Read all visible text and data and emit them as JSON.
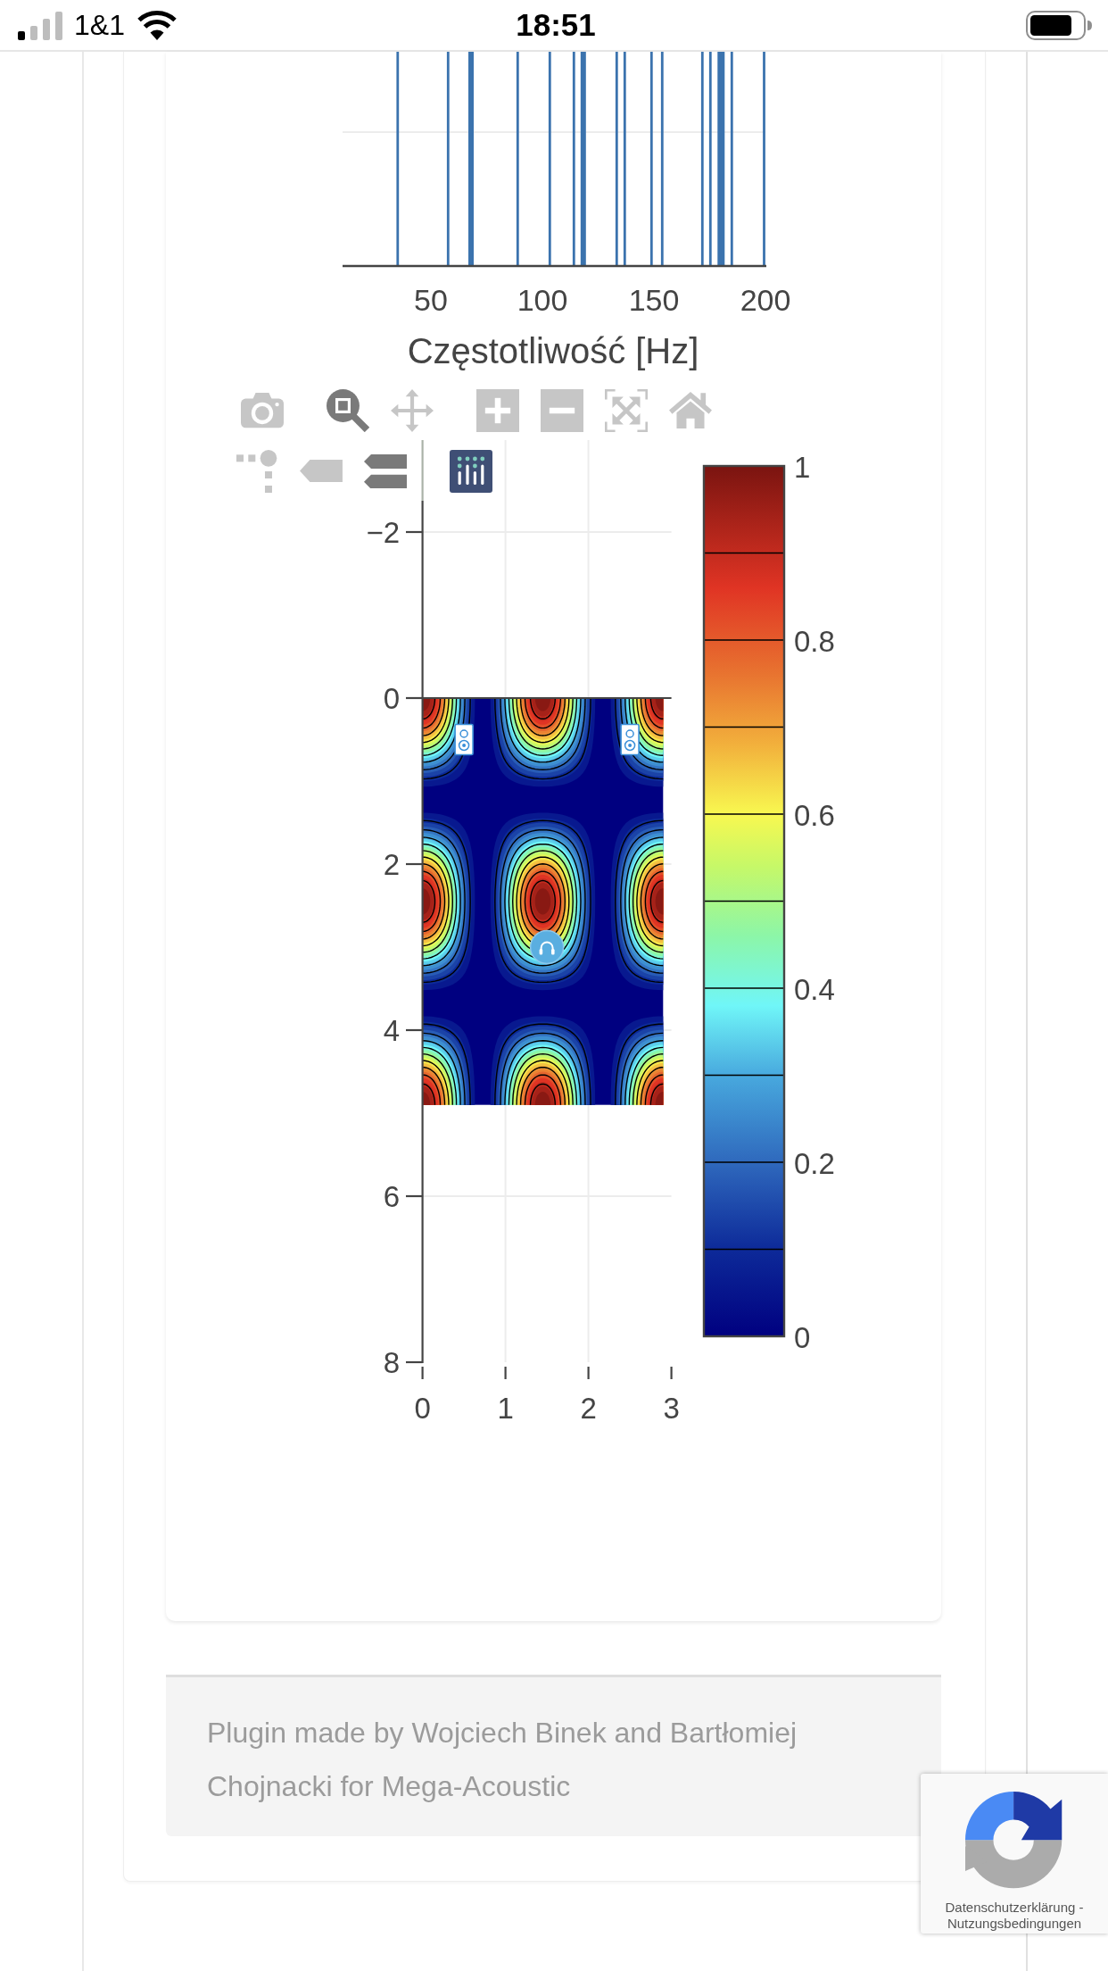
{
  "status_bar": {
    "carrier": "1&1",
    "time": "18:51"
  },
  "spectrum_chart": {
    "x_ticks": [
      "50",
      "100",
      "150",
      "200"
    ],
    "x_title": "Częstotliwość [Hz]"
  },
  "modebar": {
    "buttons": [
      {
        "kind": "camera",
        "selected": false
      },
      {
        "kind": "zoom",
        "selected": true
      },
      {
        "kind": "pan",
        "selected": false
      },
      {
        "kind": "zoom_in",
        "selected": false
      },
      {
        "kind": "zoom_out",
        "selected": false
      },
      {
        "kind": "autoscale",
        "selected": false
      },
      {
        "kind": "home",
        "selected": false
      },
      {
        "kind": "spikelines",
        "selected": false
      },
      {
        "kind": "hover_closest",
        "selected": false
      },
      {
        "kind": "hover_compare",
        "selected": true
      }
    ]
  },
  "pressure_map": {
    "y_ticks": [
      "−2",
      "0",
      "2",
      "4",
      "6",
      "8"
    ],
    "x_ticks": [
      "0",
      "1",
      "2",
      "3"
    ],
    "colorbar_ticks": [
      "1",
      "0.8",
      "0.6",
      "0.4",
      "0.2",
      "0"
    ]
  },
  "footer": {
    "text": "Plugin made by Wojciech Binek and Bartłomiej Chojnacki for Mega-Acoustic"
  },
  "privacy_badge": {
    "privacy_link": "Datenschutzerklärung",
    "separator": "-",
    "terms_link": "Nutzungsbedingungen"
  }
}
